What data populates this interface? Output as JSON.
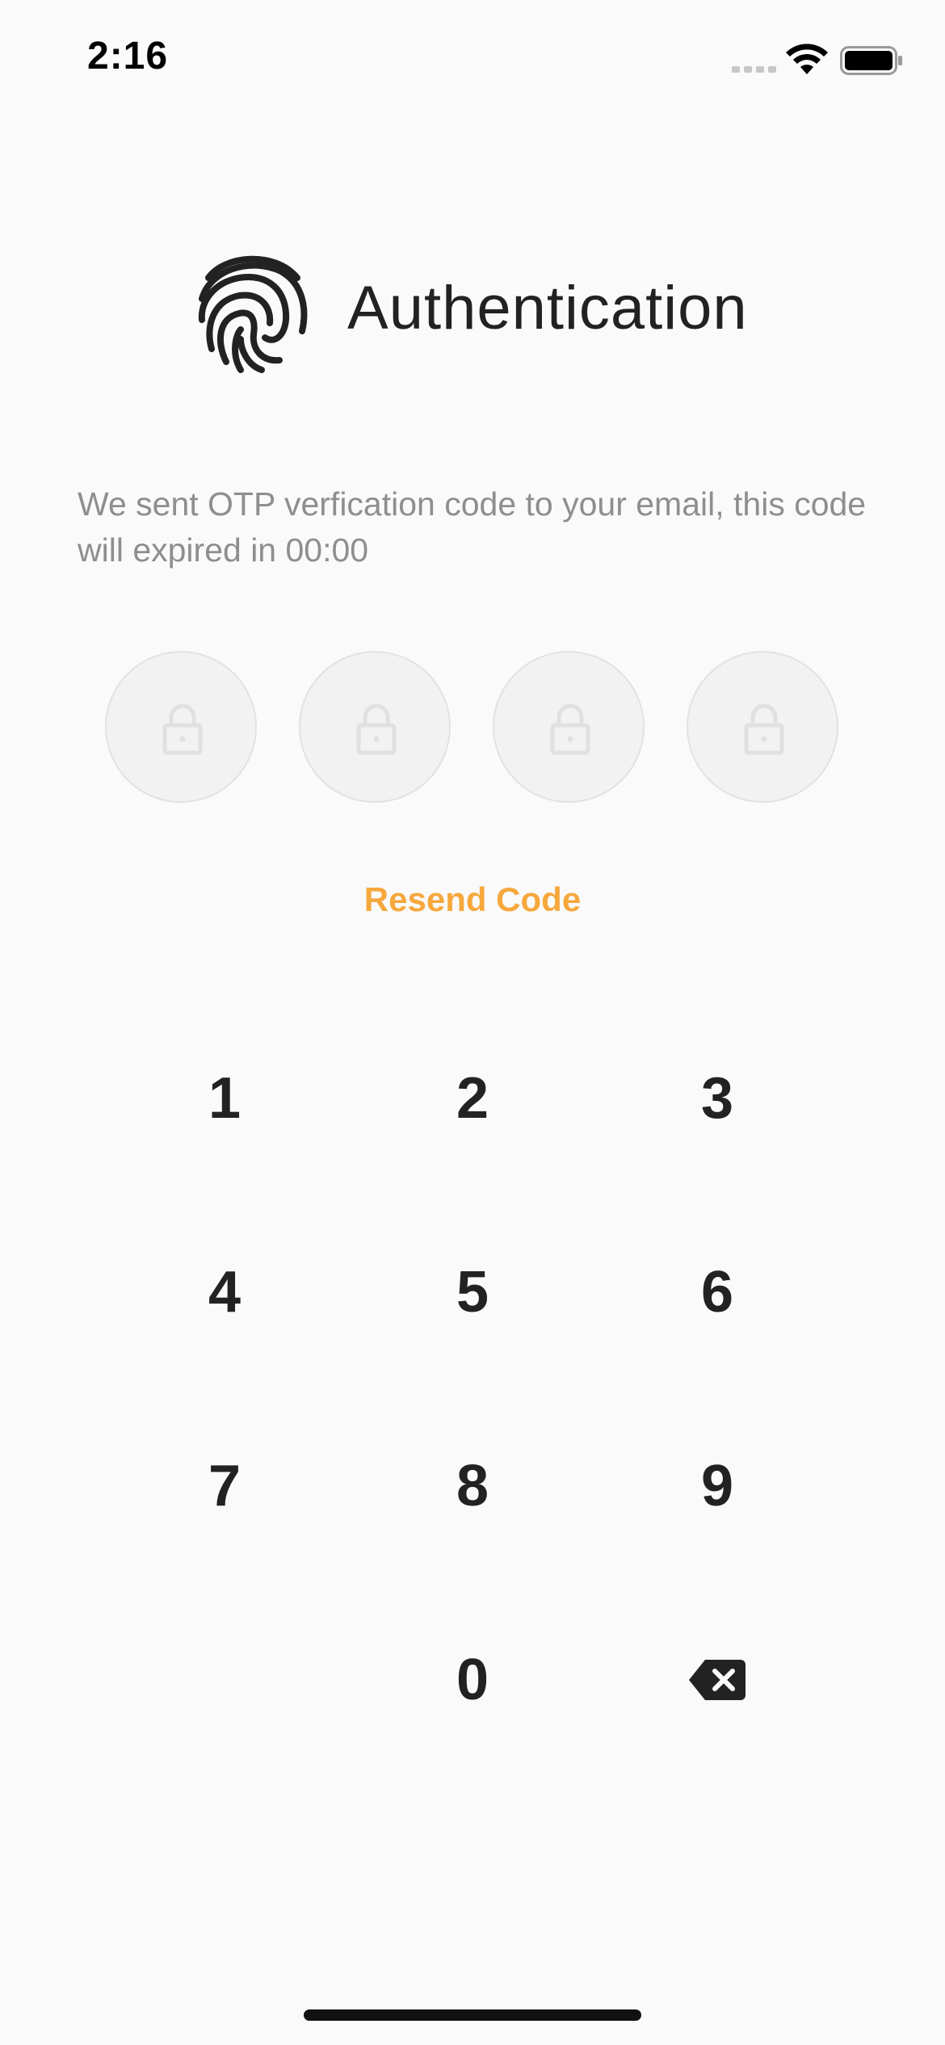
{
  "status_bar": {
    "time": "2:16"
  },
  "header": {
    "title": "Authentication",
    "icon": "fingerprint-icon"
  },
  "description": "We sent OTP verfication code to your email, this code will expired in 00:00",
  "otp": {
    "slots": 4,
    "slot_icon": "lock-icon"
  },
  "resend": {
    "label": "Resend Code"
  },
  "keypad": {
    "keys": [
      "1",
      "2",
      "3",
      "4",
      "5",
      "6",
      "7",
      "8",
      "9",
      "0"
    ],
    "backspace_icon": "backspace-icon"
  },
  "colors": {
    "accent": "#f6a83d",
    "background": "#fafafa",
    "text_primary": "#222222",
    "text_secondary": "#8e8e8e",
    "slot_border": "#e2e2e2"
  }
}
